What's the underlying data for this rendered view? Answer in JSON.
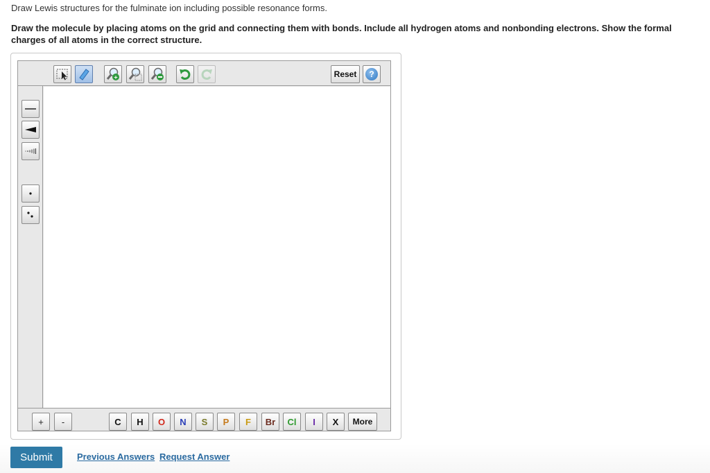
{
  "question": {
    "prompt": "Draw Lewis structures for the fulminate ion including possible resonance forms.",
    "instructions": "Draw the molecule by placing atoms on the grid and connecting them with bonds. Include all hydrogen atoms and nonbonding electrons. Show the formal charges of all atoms in the correct structure."
  },
  "toolbar": {
    "reset_label": "Reset",
    "help_label": "?",
    "tools": [
      "select-icon",
      "eraser-icon",
      "zoom-in-icon",
      "zoom-fit-icon",
      "zoom-out-icon",
      "undo-icon",
      "redo-icon"
    ]
  },
  "sidebar": {
    "tools": [
      "single-bond-icon",
      "wedge-bond-icon",
      "hashed-bond-icon",
      "lone-electron-icon",
      "lone-pair-icon"
    ]
  },
  "charges": {
    "plus": "+",
    "minus": "-"
  },
  "atoms": [
    {
      "symbol": "C",
      "color": "#111111"
    },
    {
      "symbol": "H",
      "color": "#111111"
    },
    {
      "symbol": "O",
      "color": "#d12a1e"
    },
    {
      "symbol": "N",
      "color": "#2b3fb8"
    },
    {
      "symbol": "S",
      "color": "#7a7a2a"
    },
    {
      "symbol": "P",
      "color": "#c57a1c"
    },
    {
      "symbol": "F",
      "color": "#c99a12"
    },
    {
      "symbol": "Br",
      "color": "#6b2a1e"
    },
    {
      "symbol": "Cl",
      "color": "#2f9a2f"
    },
    {
      "symbol": "I",
      "color": "#6a2aa8"
    },
    {
      "symbol": "X",
      "color": "#111111"
    }
  ],
  "more_label": "More",
  "actions": {
    "submit_label": "Submit",
    "previous_answers_label": "Previous Answers",
    "request_answer_label": "Request Answer"
  }
}
